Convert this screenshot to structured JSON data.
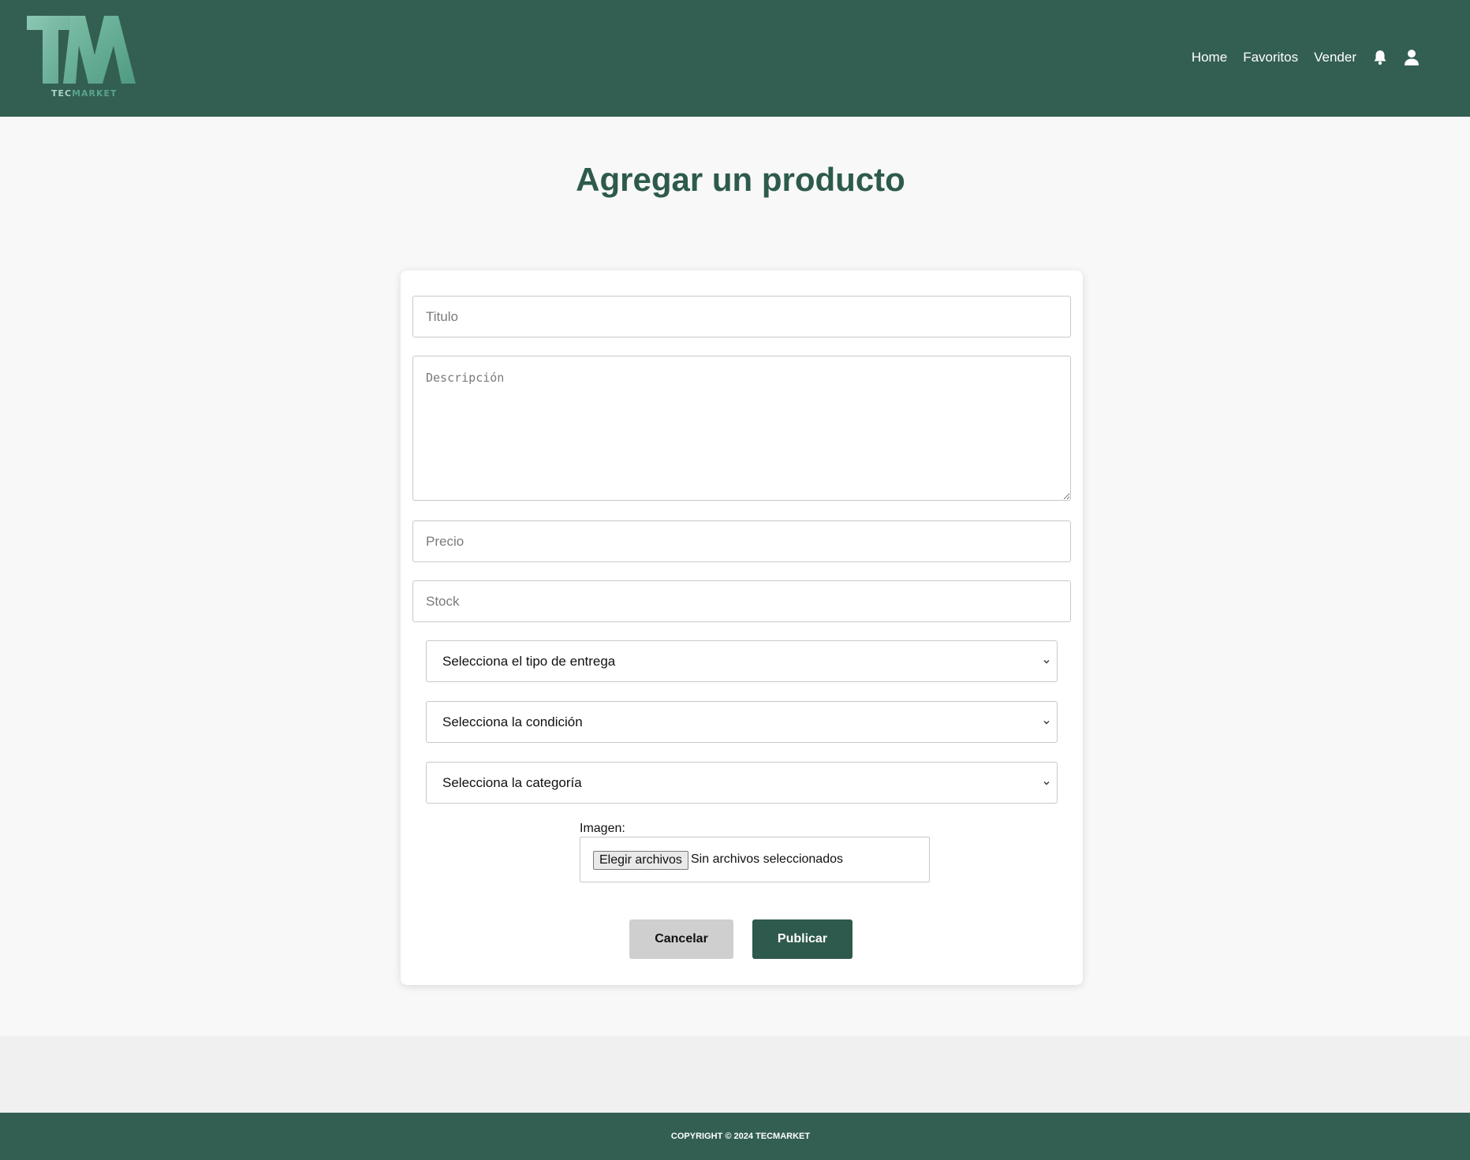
{
  "app": {
    "logo_text": "TM",
    "logo_caption_a": "TEC",
    "logo_caption_b": "MARKET"
  },
  "nav": {
    "items": [
      {
        "label": "Home"
      },
      {
        "label": "Favoritos"
      },
      {
        "label": "Vender"
      }
    ],
    "icons": [
      "bell-icon",
      "user-icon"
    ]
  },
  "page": {
    "title": "Agregar un producto"
  },
  "form": {
    "title_placeholder": "Titulo",
    "description_placeholder": "Descripción",
    "price_placeholder": "Precio",
    "stock_placeholder": "Stock",
    "delivery_select": "Selecciona el tipo de entrega",
    "condition_select": "Selecciona la condición",
    "category_select": "Selecciona la categoría",
    "image_label": "Imagen:",
    "file_button": "Elegir archivos",
    "file_status": "Sin archivos seleccionados",
    "cancel_label": "Cancelar",
    "publish_label": "Publicar"
  },
  "footer": {
    "copyright": "COPYRIGHT © 2024 TECMARKET"
  },
  "colors": {
    "brand": "#335f52",
    "title": "#2d5a4c",
    "cancel_bg": "#cfcfcf"
  }
}
